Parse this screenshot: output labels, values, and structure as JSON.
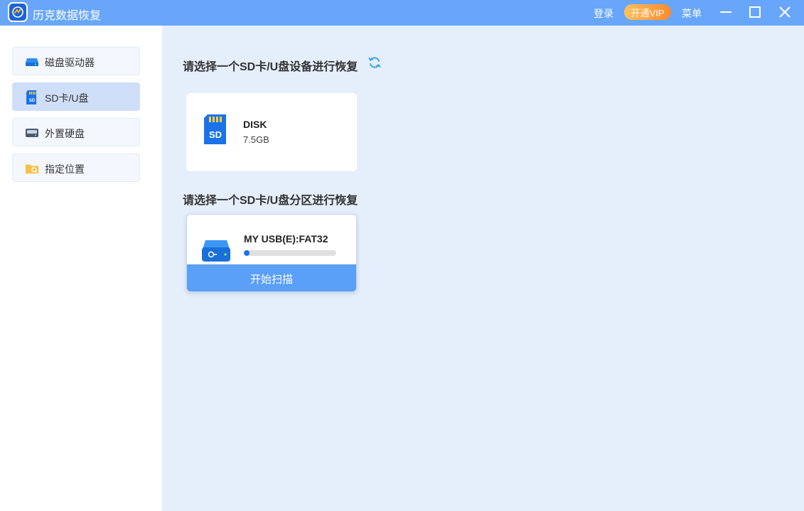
{
  "titlebar": {
    "app_title": "历克数据恢复",
    "login_label": "登录",
    "vip_label": "开通VIP",
    "menu_label": "菜单"
  },
  "sidebar": {
    "items": [
      {
        "label": "磁盘驱动器",
        "icon": "disk-drive-icon"
      },
      {
        "label": "SD卡/U盘",
        "icon": "sd-card-icon",
        "active": true
      },
      {
        "label": "外置硬盘",
        "icon": "external-drive-icon"
      },
      {
        "label": "指定位置",
        "icon": "folder-icon"
      }
    ]
  },
  "main": {
    "device_section_title": "请选择一个SD卡/U盘设备进行恢复",
    "device": {
      "name": "DISK",
      "size": "7.5GB"
    },
    "partition_section_title": "请选择一个SD卡/U盘分区进行恢复",
    "partition": {
      "name": "MY USB(E):FAT32",
      "usage_fraction": 0.06
    },
    "scan_button_label": "开始扫描"
  },
  "colors": {
    "titlebar": "#67a6fb",
    "accent": "#1a73e8",
    "scan_button": "#5a9ff8",
    "main_bg": "#e5eefb",
    "sidebar_active": "#cfdffa",
    "vip_orange": "#ff8a2c"
  }
}
